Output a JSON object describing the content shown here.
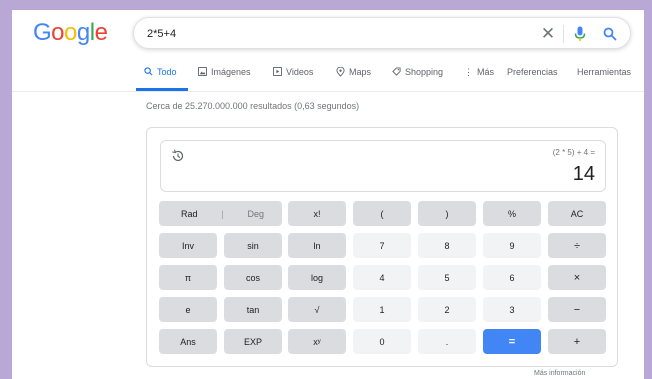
{
  "logo": {
    "letters": [
      "G",
      "o",
      "o",
      "g",
      "l",
      "e"
    ]
  },
  "search": {
    "query": "2*5+4"
  },
  "tabs": [
    {
      "label": "Todo",
      "icon": "search-icon"
    },
    {
      "label": "Imágenes",
      "icon": "image-icon"
    },
    {
      "label": "Videos",
      "icon": "video-icon"
    },
    {
      "label": "Maps",
      "icon": "map-pin-icon"
    },
    {
      "label": "Shopping",
      "icon": "tag-icon"
    },
    {
      "label": "Más",
      "icon": "more-vertical-icon"
    },
    {
      "label": "Preferencias"
    },
    {
      "label": "Herramientas"
    }
  ],
  "stats": "Cerca de 25.270.000.000 resultados (0,63 segundos)",
  "calculator": {
    "expression": "(2 * 5) + 4 =",
    "result": "14",
    "rad_label": "Rad",
    "rad_sep": "|",
    "deg_label": "Deg",
    "keys": [
      [
        "x!",
        "(",
        ")",
        "%",
        "AC"
      ],
      [
        "Inv",
        "sin",
        "ln",
        "7",
        "8",
        "9",
        "÷"
      ],
      [
        "π",
        "cos",
        "log",
        "4",
        "5",
        "6",
        "×"
      ],
      [
        "e",
        "tan",
        "√",
        "1",
        "2",
        "3",
        "−"
      ],
      [
        "Ans",
        "EXP",
        "xʸ",
        "0",
        ".",
        "=",
        "+"
      ]
    ]
  },
  "more_info": "Más información",
  "colors": {
    "accent": "#1a73e8",
    "equals_key": "#4285f4",
    "function_key": "#dadce0",
    "number_key": "#f1f3f4",
    "frame": "#b9a7d6"
  }
}
